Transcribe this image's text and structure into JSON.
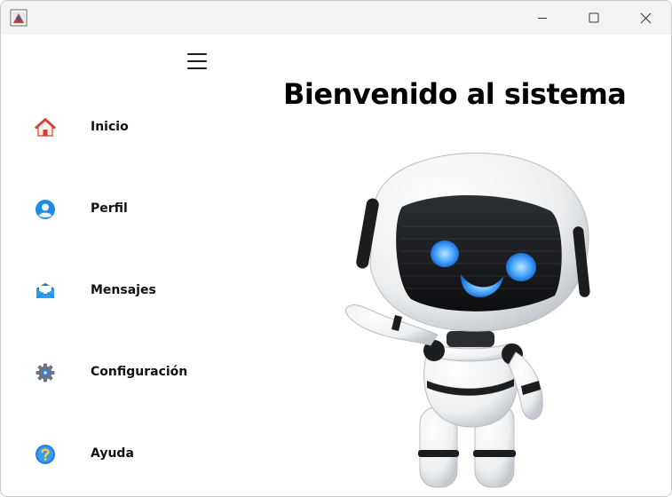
{
  "window": {
    "controls": {
      "minimize": "minimize-icon",
      "maximize": "maximize-icon",
      "close": "close-icon"
    }
  },
  "menu": {
    "toggle_icon": "hamburger-menu-icon",
    "items": [
      {
        "label": "Inicio",
        "icon": "home-icon"
      },
      {
        "label": "Perfil",
        "icon": "user-icon"
      },
      {
        "label": "Mensajes",
        "icon": "mail-icon"
      },
      {
        "label": "Configuración",
        "icon": "gear-icon"
      },
      {
        "label": "Ayuda",
        "icon": "help-icon"
      }
    ]
  },
  "main": {
    "title": "Bienvenido al sistema",
    "illustration": "robot-illustration"
  },
  "colors": {
    "title_text": "#000000",
    "nav_text": "#111111",
    "titlebar_bg": "#f3f3f3",
    "robot_eyes": "#4aa8ff"
  }
}
